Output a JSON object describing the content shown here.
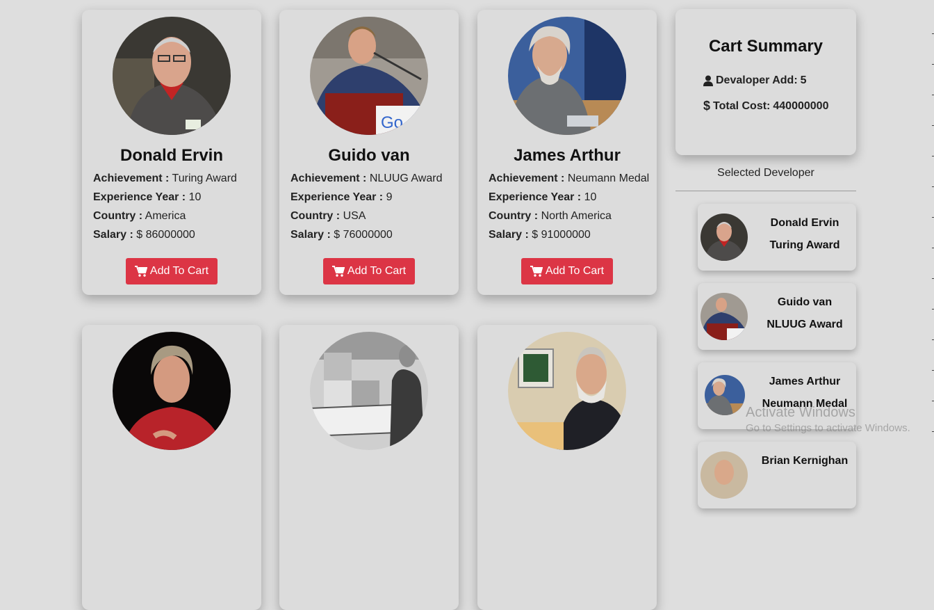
{
  "developers": [
    {
      "name": "Donald Ervin",
      "achievement_label": "Achievement :",
      "achievement": "Turing Award",
      "experience_label": "Experience Year :",
      "experience": "10",
      "country_label": "Country :",
      "country": "America",
      "salary_label": "Salary :",
      "salary": "$ 86000000",
      "button": "Add To Cart"
    },
    {
      "name": "Guido van",
      "achievement_label": "Achievement :",
      "achievement": "NLUUG Award",
      "experience_label": "Experience Year :",
      "experience": "9",
      "country_label": "Country :",
      "country": "USA",
      "salary_label": "Salary :",
      "salary": "$ 76000000",
      "button": "Add To Cart"
    },
    {
      "name": "James Arthur",
      "achievement_label": "Achievement :",
      "achievement": "Neumann Medal",
      "experience_label": "Experience Year :",
      "experience": "10",
      "country_label": "Country :",
      "country": "North America",
      "salary_label": "Salary :",
      "salary": "$ 91000000",
      "button": "Add To Cart"
    }
  ],
  "cart": {
    "title": "Cart Summary",
    "developer_add_label": "Devaloper Add:",
    "developer_add": "5",
    "total_cost_label": "Total Cost:",
    "total_cost": "440000000"
  },
  "selected": {
    "heading": "Selected Developer",
    "items": [
      {
        "name": "Donald Ervin",
        "award": "Turing Award"
      },
      {
        "name": "Guido van",
        "award": "NLUUG Award"
      },
      {
        "name": "James Arthur",
        "award": "Neumann Medal"
      },
      {
        "name": "Brian Kernighan",
        "award": ""
      }
    ]
  },
  "watermark": {
    "title": "Activate Windows",
    "subtitle": "Go to Settings to activate Windows."
  },
  "colors": {
    "accent": "#dc3545",
    "card": "#dcdcdc",
    "background": "#dedede"
  }
}
